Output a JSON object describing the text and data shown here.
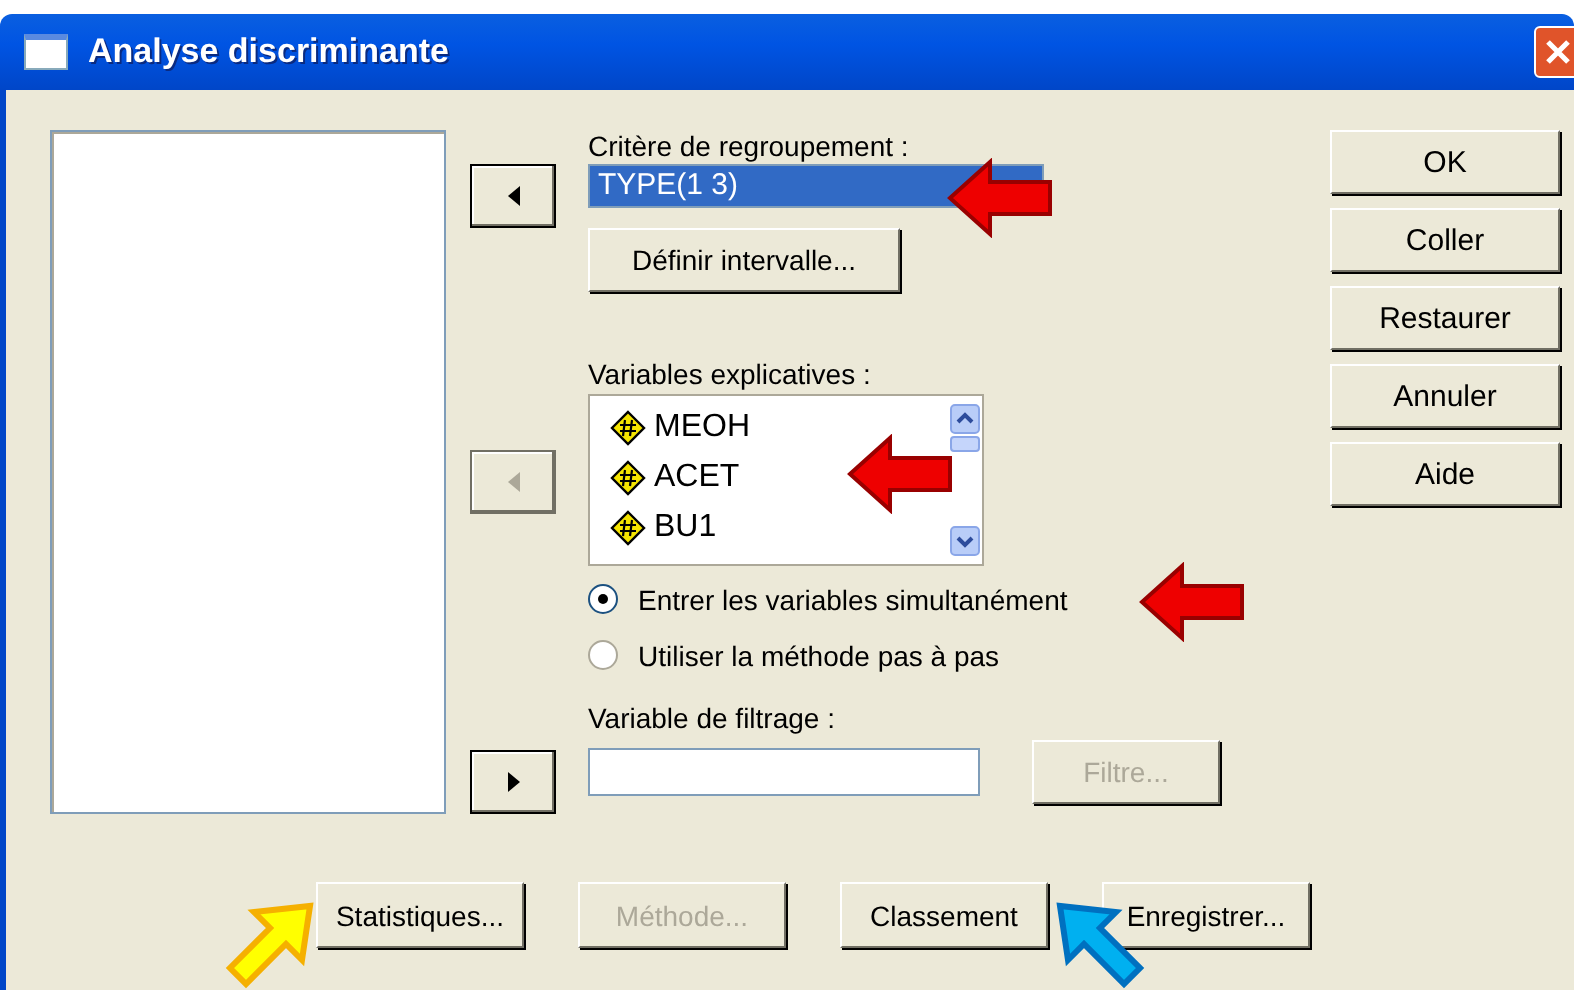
{
  "window": {
    "title": "Analyse discriminante"
  },
  "transfer_buttons": [
    {
      "kind": "left",
      "disabled": false
    },
    {
      "kind": "left",
      "disabled": true
    },
    {
      "kind": "right",
      "disabled": false
    }
  ],
  "grouping": {
    "label": "Critère de regroupement :",
    "value": "TYPE(1 3)",
    "define_button": "Définir intervalle..."
  },
  "explanatory": {
    "label": "Variables explicatives :",
    "items": [
      "MEOH",
      "ACET",
      "BU1"
    ]
  },
  "methods": [
    {
      "label": "Entrer les variables simultanément",
      "selected": true
    },
    {
      "label": "Utiliser la méthode pas à pas",
      "selected": false
    }
  ],
  "filter": {
    "label": "Variable de filtrage :",
    "button": {
      "label": "Filtre...",
      "disabled": true
    }
  },
  "side_buttons": [
    "OK",
    "Coller",
    "Restaurer",
    "Annuler",
    "Aide"
  ],
  "bottom_buttons": [
    {
      "label": "Statistiques...",
      "disabled": false
    },
    {
      "label": "Méthode...",
      "disabled": true
    },
    {
      "label": "Classement",
      "disabled": false
    },
    {
      "label": "Enregistrer...",
      "disabled": false
    }
  ]
}
